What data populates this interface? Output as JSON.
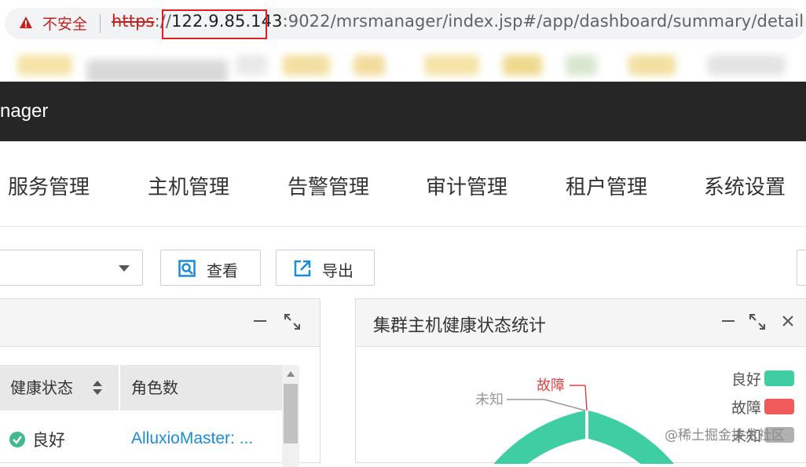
{
  "browser": {
    "insecure_label": "不安全",
    "url_proto": "https",
    "url_sep": "://",
    "url_host": "122.9.85.143",
    "url_rest": ":9022/mrsmanager/index.jsp#/app/dashboard/summary/detail"
  },
  "header": {
    "app_title": "nager"
  },
  "menu": {
    "items": [
      {
        "label": "服务管理"
      },
      {
        "label": "主机管理"
      },
      {
        "label": "告警管理"
      },
      {
        "label": "审计管理"
      },
      {
        "label": "租户管理"
      },
      {
        "label": "系统设置"
      }
    ]
  },
  "toolbar": {
    "select_value": "",
    "view_label": "查看",
    "export_label": "导出"
  },
  "left_panel": {
    "columns": [
      "健康状态",
      "角色数"
    ],
    "rows": [
      {
        "health": "良好",
        "roles": "AlluxioMaster: ..."
      }
    ]
  },
  "right_panel": {
    "title": "集群主机健康状态统计",
    "chart_data": {
      "type": "pie",
      "title": "集群主机健康状态统计",
      "labels": [
        "良好",
        "故障",
        "未知"
      ],
      "legend": [
        "良好",
        "故障",
        "未知"
      ],
      "legend_position": "top-right",
      "colors": {
        "良好": "#3fcda3",
        "故障": "#f05a5a",
        "未知": "#b0b0b0"
      },
      "annotations": [
        "故障",
        "未知"
      ]
    }
  },
  "watermark": "@稀土掘金技术社区",
  "icons": [
    "warning-icon",
    "search-view-icon",
    "export-icon",
    "minimize-icon",
    "maximize-icon",
    "close-icon",
    "check-circle-icon",
    "sort-icon",
    "dropdown-caret-icon"
  ]
}
